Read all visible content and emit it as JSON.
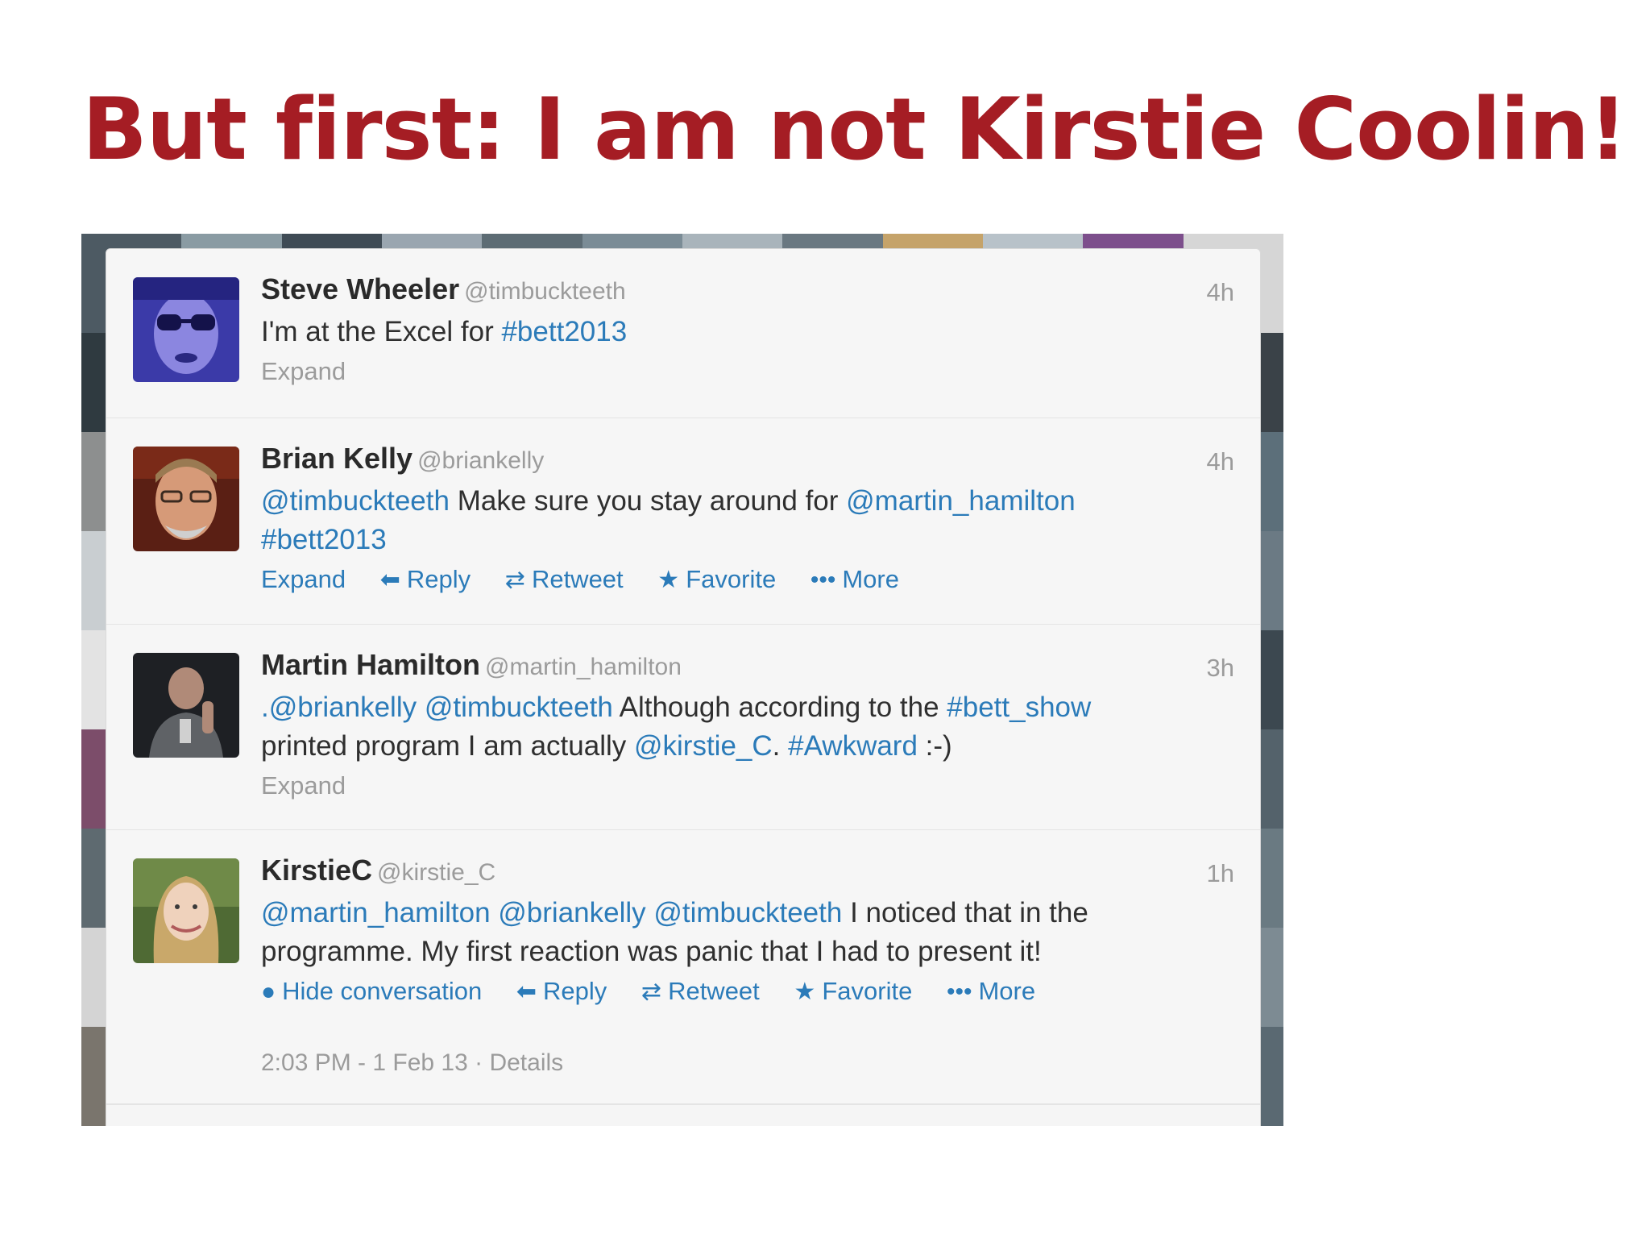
{
  "slide": {
    "title": "But first: I am not Kirstie Coolin!"
  },
  "tweets": [
    {
      "name": "Steve Wheeler",
      "handle": "@timbuckteeth",
      "time": "4h",
      "text": [
        {
          "t": "I'm at the Excel for ",
          "link": false
        },
        {
          "t": "#bett2013",
          "link": true
        }
      ],
      "expand": "Expand"
    },
    {
      "name": "Brian Kelly",
      "handle": "@briankelly",
      "time": "4h",
      "text": [
        {
          "t": "@timbuckteeth",
          "link": true
        },
        {
          "t": " Make sure you stay around for ",
          "link": false
        },
        {
          "t": "@martin_hamilton",
          "link": true
        },
        {
          "t": " #bett2013",
          "link": true
        }
      ],
      "actions": {
        "expand": "Expand",
        "reply": "Reply",
        "retweet": "Retweet",
        "favorite": "Favorite",
        "more": "More"
      }
    },
    {
      "name": "Martin Hamilton",
      "handle": "@martin_hamilton",
      "time": "3h",
      "text": [
        {
          "t": ".@briankelly",
          "link": true
        },
        {
          "t": " ",
          "link": false
        },
        {
          "t": "@timbuckteeth",
          "link": true
        },
        {
          "t": " Although according to the ",
          "link": false
        },
        {
          "t": "#bett_show",
          "link": true
        },
        {
          "t": " printed program I am actually ",
          "link": false
        },
        {
          "t": "@kirstie_C",
          "link": true
        },
        {
          "t": ". ",
          "link": false
        },
        {
          "t": "#Awkward",
          "link": true
        },
        {
          "t": " :-)",
          "link": false
        }
      ],
      "expand": "Expand"
    },
    {
      "name": "KirstieC",
      "handle": "@kirstie_C",
      "time": "1h",
      "text": [
        {
          "t": "@martin_hamilton",
          "link": true
        },
        {
          "t": " ",
          "link": false
        },
        {
          "t": "@briankelly",
          "link": true
        },
        {
          "t": " ",
          "link": false
        },
        {
          "t": "@timbuckteeth",
          "link": true
        },
        {
          "t": " I noticed that in the programme. My first reaction was panic that I had to present it!",
          "link": false
        }
      ],
      "actions": {
        "hide": "Hide conversation",
        "reply": "Reply",
        "retweet": "Retweet",
        "favorite": "Favorite",
        "more": "More"
      },
      "meta": "2:03 PM - 1 Feb 13 · Details"
    }
  ],
  "icons": {
    "reply": "reply-arrow-icon",
    "retweet": "retweet-icon",
    "favorite": "star-icon",
    "more": "ellipsis-icon",
    "hide": "speech-bubble-icon"
  },
  "colors": {
    "title": "#a51d24",
    "link": "#2b7bb9",
    "muted": "#9b9b9b"
  }
}
